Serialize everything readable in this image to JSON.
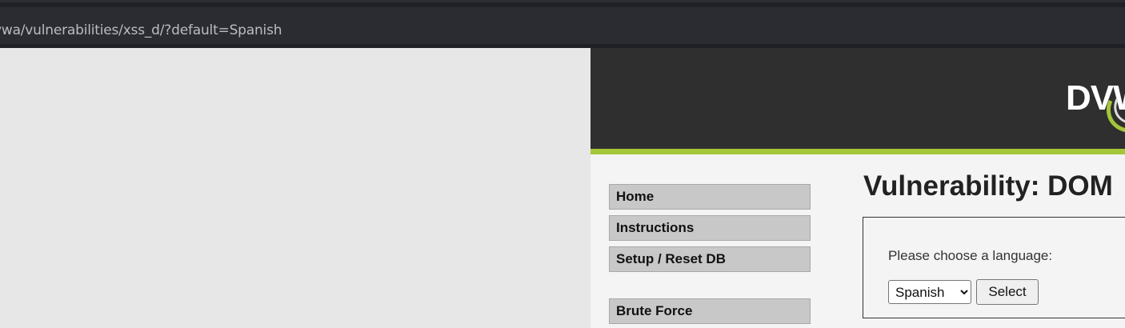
{
  "browser": {
    "url": "vwa/vulnerabilities/xss_d/?default=Spanish"
  },
  "site": {
    "logo_text": "DVW",
    "page_title": "Vulnerability: DOM",
    "menu": [
      {
        "label": "Home"
      },
      {
        "label": "Instructions"
      },
      {
        "label": "Setup / Reset DB"
      },
      {
        "label": "Brute Force"
      }
    ],
    "form": {
      "prompt": "Please choose a language:",
      "selected_language": "Spanish",
      "submit_label": "Select"
    }
  },
  "colors": {
    "header_bg": "#2f2f2f",
    "accent_green": "#a4c63a",
    "menu_bg": "#c8c8c8"
  }
}
